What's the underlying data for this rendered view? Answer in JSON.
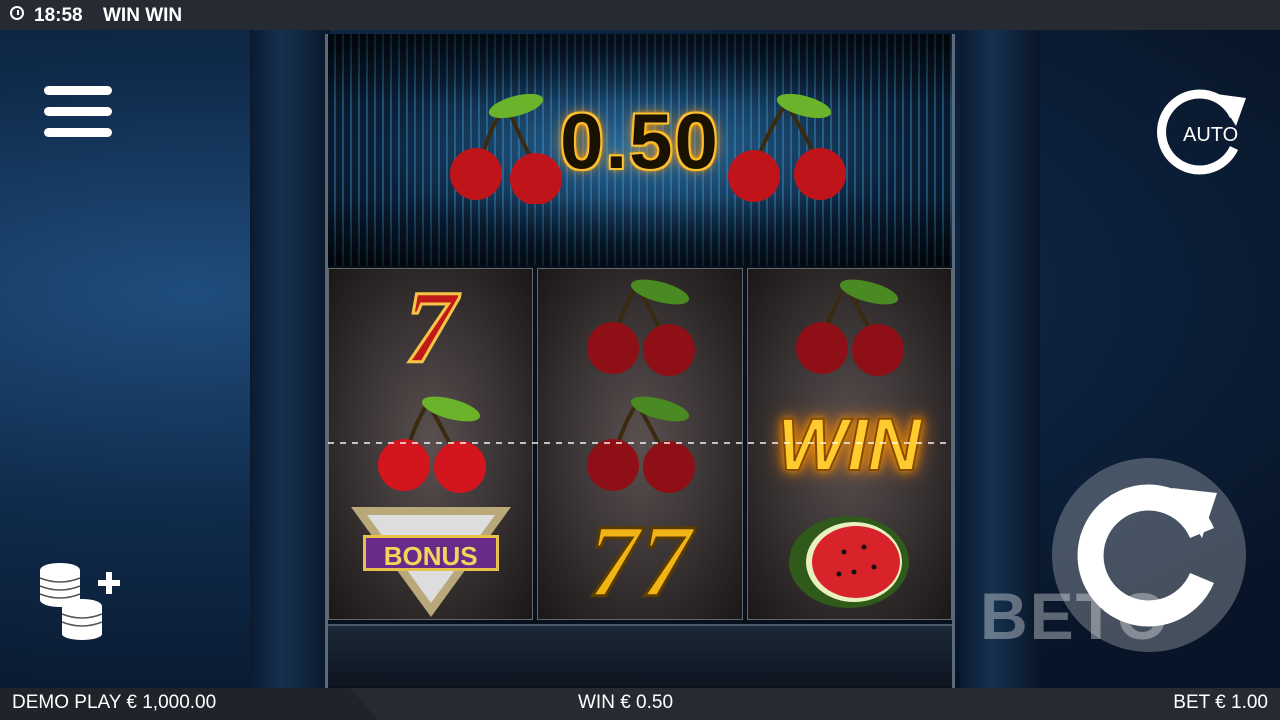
{
  "top_bar": {
    "time": "18:58",
    "game_title": "WIN WIN"
  },
  "win_display": {
    "amount": "0.50"
  },
  "reels": [
    [
      "seven-red",
      "cherry",
      "bonus"
    ],
    [
      "cherry",
      "cherry",
      "seven-gold"
    ],
    [
      "cherry",
      "win",
      "watermelon"
    ]
  ],
  "symbols": {
    "bonus_label": "BONUS",
    "win_label": "WIN",
    "seven_glyph": "7"
  },
  "controls": {
    "auto_label": "AUTO"
  },
  "bottom_bar": {
    "balance": "DEMO PLAY € 1,000.00",
    "win": "WIN € 0.50",
    "bet": "BET € 1.00"
  },
  "watermark": "BETO",
  "colors": {
    "accent_gold": "#ffcb2e",
    "cherry_red": "#c11919",
    "bar_bg": "#262b33"
  }
}
